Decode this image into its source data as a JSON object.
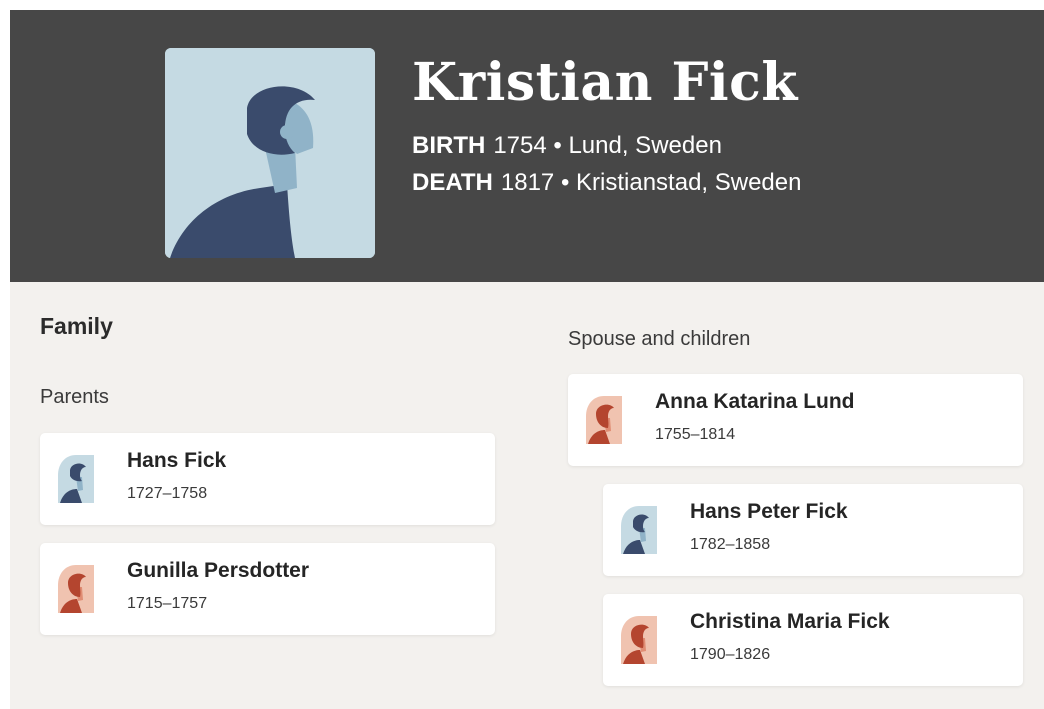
{
  "person": {
    "name": "Kristian Fick",
    "birth_label": "BIRTH",
    "birth_value": "1754 • Lund, Sweden",
    "death_label": "DEATH",
    "death_value": "1817 • Kristianstad, Sweden",
    "portrait_icon": "male-silhouette-icon"
  },
  "family": {
    "title": "Family",
    "parents_label": "Parents",
    "spouse_label": "Spouse and children",
    "parents": [
      {
        "name": "Hans Fick",
        "dates": "1727–1758",
        "icon": "male-avatar-icon"
      },
      {
        "name": "Gunilla Persdotter",
        "dates": "1715–1757",
        "icon": "female-avatar-icon"
      }
    ],
    "spouse": {
      "name": "Anna Katarina Lund",
      "dates": "1755–1814",
      "icon": "female-avatar-icon"
    },
    "children": [
      {
        "name": "Hans Peter Fick",
        "dates": "1782–1858",
        "icon": "male-avatar-icon"
      },
      {
        "name": "Christina Maria Fick",
        "dates": "1790–1826",
        "icon": "female-avatar-icon"
      }
    ]
  },
  "colors": {
    "header_bg": "#474747",
    "page_bg": "#f3f1ee",
    "male_avatar_bg": "#c5dae3",
    "male_figure": "#3a4b6c",
    "female_avatar_bg": "#f0c3b0",
    "female_figure": "#b4452f"
  }
}
